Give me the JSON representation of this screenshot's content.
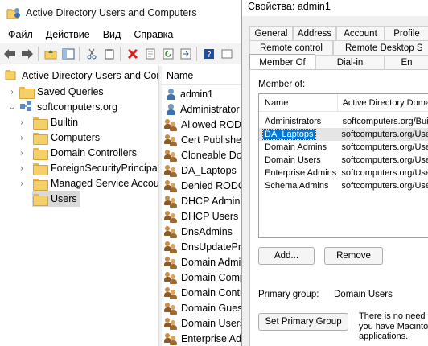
{
  "aduc": {
    "title": "Active Directory Users and Computers",
    "menu": [
      "Файл",
      "Действие",
      "Вид",
      "Справка"
    ],
    "tree": {
      "root": "Active Directory Users and Com",
      "saved_queries": "Saved Queries",
      "domain": "softcomputers.org",
      "folders": [
        "Builtin",
        "Computers",
        "Domain Controllers",
        "ForeignSecurityPrincipals",
        "Managed Service Accoun",
        "Users"
      ],
      "selected": "Users"
    },
    "list": {
      "header": "Name",
      "items": [
        {
          "name": "admin1",
          "icon": "user-icon"
        },
        {
          "name": "Administrator",
          "icon": "user-icon"
        },
        {
          "name": "Allowed RODC",
          "icon": "group-icon"
        },
        {
          "name": "Cert Publisher",
          "icon": "group-icon"
        },
        {
          "name": "Cloneable Dom",
          "icon": "group-icon"
        },
        {
          "name": "DA_Laptops",
          "icon": "group-icon"
        },
        {
          "name": "Denied RODC",
          "icon": "group-icon"
        },
        {
          "name": "DHCP Admini",
          "icon": "group-icon"
        },
        {
          "name": "DHCP Users",
          "icon": "group-icon"
        },
        {
          "name": "DnsAdmins",
          "icon": "group-icon"
        },
        {
          "name": "DnsUpdatePro",
          "icon": "group-icon"
        },
        {
          "name": "Domain Admi",
          "icon": "group-icon"
        },
        {
          "name": "Domain Comp",
          "icon": "group-icon"
        },
        {
          "name": "Domain Contr",
          "icon": "group-icon"
        },
        {
          "name": "Domain Guest",
          "icon": "group-icon"
        },
        {
          "name": "Domain Users",
          "icon": "group-icon"
        },
        {
          "name": "Enterprise Adr",
          "icon": "group-icon"
        }
      ]
    }
  },
  "props": {
    "title": "Свойства: admin1",
    "tabs_row1": [
      "General",
      "Address",
      "Account",
      "Profile"
    ],
    "tabs_row2": [
      "Remote control",
      "Remote Desktop S"
    ],
    "tabs_row3": [
      "Member Of",
      "Dial-in",
      "En"
    ],
    "active_tab": "Member Of",
    "member_of_label": "Member of:",
    "columns": [
      "Name",
      "Active Directory Doma"
    ],
    "members": [
      {
        "name": "Administrators",
        "path": "softcomputers.org/Buil"
      },
      {
        "name": "DA_Laptops",
        "path": "softcomputers.org/Use"
      },
      {
        "name": "Domain Admins",
        "path": "softcomputers.org/Use"
      },
      {
        "name": "Domain Users",
        "path": "softcomputers.org/Use"
      },
      {
        "name": "Enterprise Admins",
        "path": "softcomputers.org/Use"
      },
      {
        "name": "Schema Admins",
        "path": "softcomputers.org/Use"
      }
    ],
    "selected_member": "DA_Laptops",
    "add_button": "Add...",
    "remove_button": "Remove",
    "primary_group_label": "Primary group:",
    "primary_group_value": "Domain Users",
    "set_primary_button": "Set Primary Group",
    "note_lines": [
      "There is no need to",
      "you have Macintos",
      "applications."
    ]
  }
}
